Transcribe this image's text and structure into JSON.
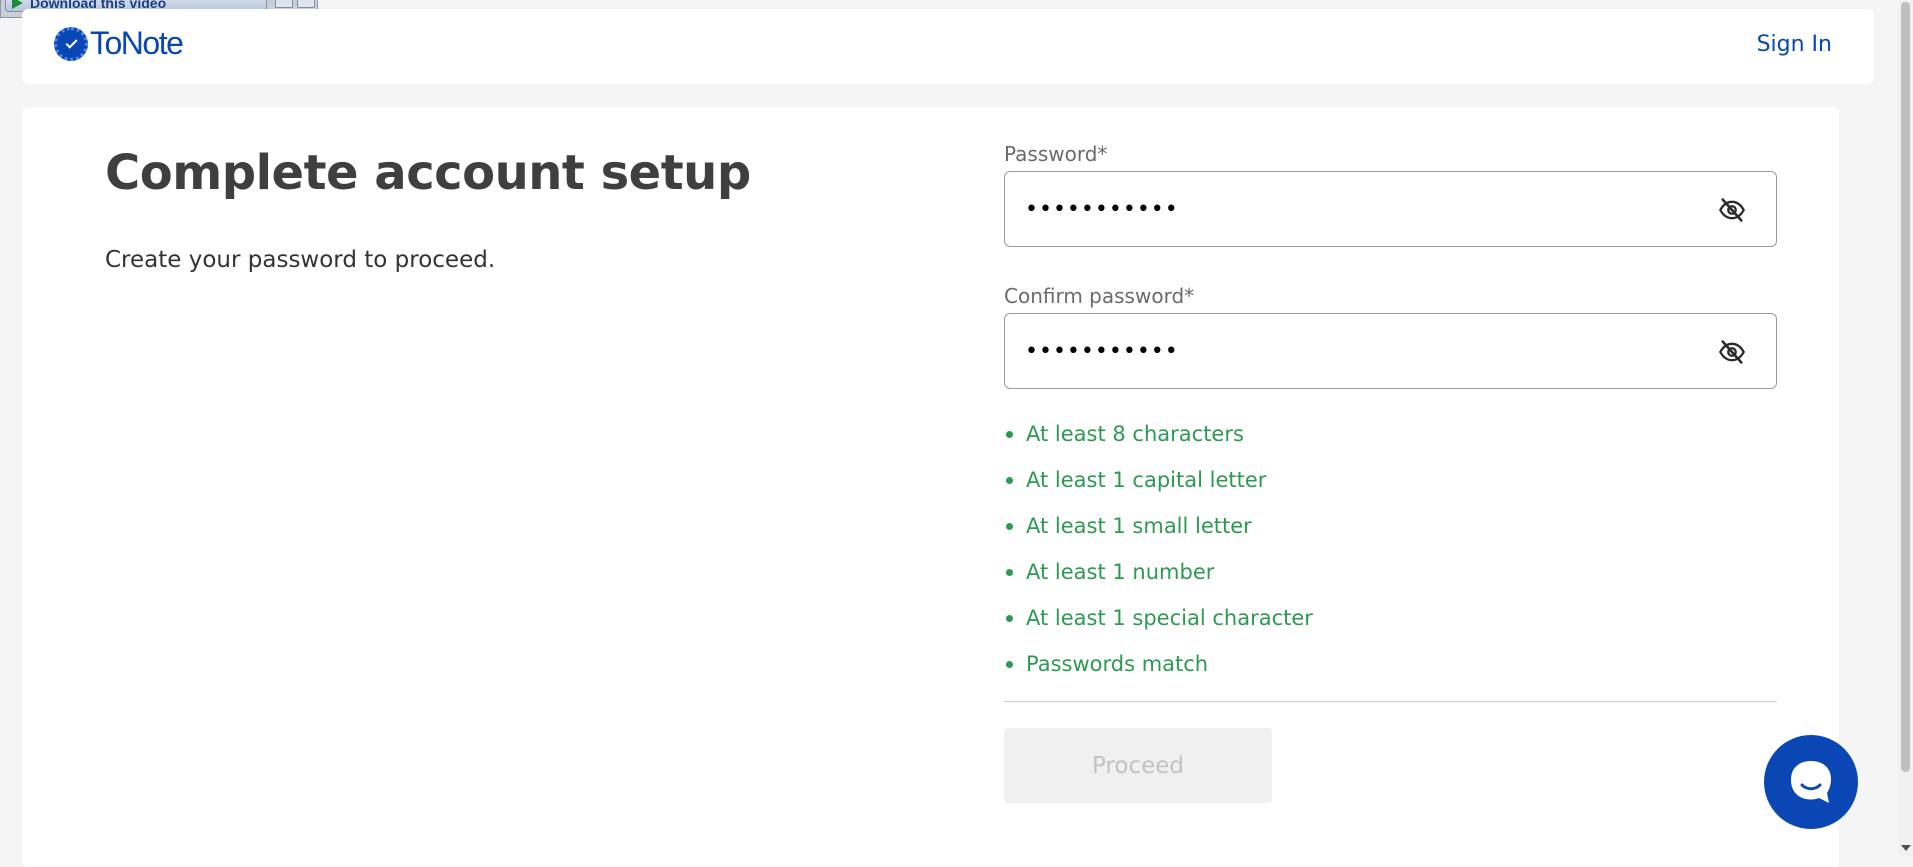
{
  "overlay": {
    "download_label": "Download this video"
  },
  "header": {
    "logo_text": "ToNote",
    "sign_in": "Sign In"
  },
  "main": {
    "title": "Complete account setup",
    "subtitle": "Create your password to proceed."
  },
  "form": {
    "password": {
      "label": "Password*",
      "value": "•••••••••••",
      "toggle_icon": "eye-slash-icon"
    },
    "confirm_password": {
      "label": "Confirm password*",
      "value": "•••••••••••",
      "toggle_icon": "eye-slash-icon"
    },
    "rules": [
      "At least 8 characters",
      "At least 1 capital letter",
      "At least 1 small letter",
      "At least 1 number",
      "At least 1 special character",
      "Passwords match"
    ],
    "proceed_label": "Proceed"
  },
  "chat": {
    "icon": "chat-bubble-icon"
  },
  "colors": {
    "brand": "#0a47b5",
    "rule_ok": "#2c9a53",
    "heading": "#3f3f3f",
    "button_disabled_bg": "#f0f0f0",
    "button_disabled_text": "#c2c2c2"
  }
}
